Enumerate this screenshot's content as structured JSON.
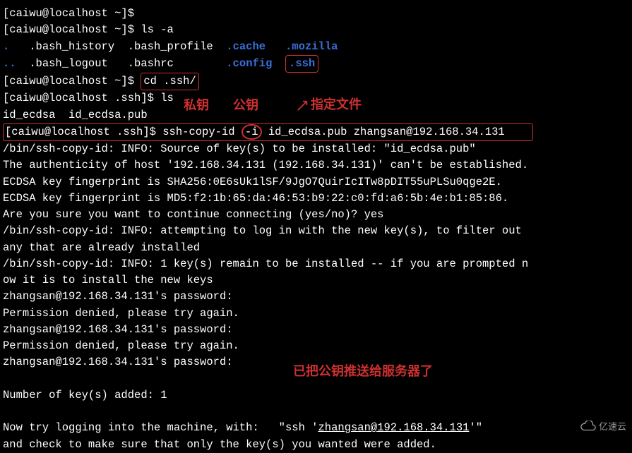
{
  "prompt1": "[caiwu@localhost ~]$",
  "prompt_ssh": "[caiwu@localhost .ssh]$",
  "cmd_ls_a": "ls -a",
  "ls_dot": ".",
  "ls_dotdot": "..",
  "ls_bash_history": ".bash_history",
  "ls_bash_logout": ".bash_logout",
  "ls_bash_profile": ".bash_profile",
  "ls_bashrc": ".bashrc",
  "ls_cache": ".cache",
  "ls_config": ".config",
  "ls_mozilla": ".mozilla",
  "ls_ssh": ".ssh",
  "cmd_cd_ssh": "cd .ssh/",
  "cmd_ls": "ls",
  "file_id_ecdsa": "id_ecdsa",
  "file_id_ecdsa_pub": "id_ecdsa.pub",
  "anno_private": "私钥",
  "anno_public": "公钥",
  "anno_file": "指定文件",
  "ssh_copy_id": "ssh-copy-id",
  "flag_i": "-i",
  "arg_pub": "id_ecdsa.pub",
  "arg_target": "zhangsan@192.168.34.131",
  "out1": "/bin/ssh-copy-id: INFO: Source of key(s) to be installed: \"id_ecdsa.pub\"",
  "out2": "The authenticity of host '192.168.34.131 (192.168.34.131)' can't be established.",
  "out3": "ECDSA key fingerprint is SHA256:0E6sUk1lSF/9JgO7QuirIcITw8pDIT55uPLSu0qge2E.",
  "out4": "ECDSA key fingerprint is MD5:f2:1b:65:da:46:53:b9:22:c0:fd:a6:5b:4e:b1:85:86.",
  "out5": "Are you sure you want to continue connecting (yes/no)? yes",
  "out6": "/bin/ssh-copy-id: INFO: attempting to log in with the new key(s), to filter out",
  "out7": "any that are already installed",
  "out8": "/bin/ssh-copy-id: INFO: 1 key(s) remain to be installed -- if you are prompted n",
  "out9": "ow it is to install the new keys",
  "out10": "zhangsan@192.168.34.131's password:",
  "out11": "Permission denied, please try again.",
  "out12": "zhangsan@192.168.34.131's password:",
  "out13": "Permission denied, please try again.",
  "out14": "zhangsan@192.168.34.131's password:",
  "anno_pushed": "已把公钥推送给服务器了",
  "out15": "Number of key(s) added: 1",
  "out16a": "Now try logging into the machine, with:   \"ssh '",
  "out16b": "zhangsan@192.168.34.131",
  "out16c": "'\"",
  "out17": "and check to make sure that only the key(s) you wanted were added.",
  "watermark": "亿速云"
}
